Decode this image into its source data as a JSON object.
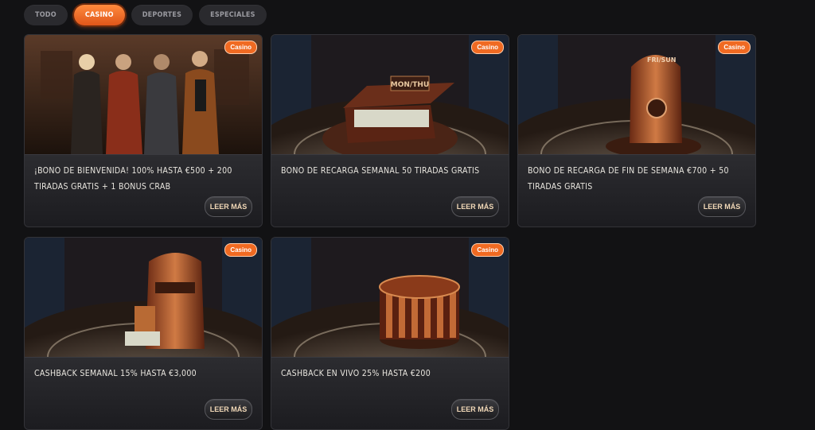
{
  "tabs": [
    {
      "label": "TODO",
      "active": false
    },
    {
      "label": "CASINO",
      "active": true
    },
    {
      "label": "DEPORTES",
      "active": false
    },
    {
      "label": "ESPECIALES",
      "active": false
    }
  ],
  "promotions": [
    {
      "badge": "Casino",
      "title": "¡BONO DE BIENVENIDA! 100% HASTA €500 + 200 TIRADAS GRATIS + 1 BONUS CRAB",
      "button": "LEER MÁS",
      "image": "welcome-characters"
    },
    {
      "badge": "Casino",
      "title": "BONO DE RECARGA SEMANAL 50 TIRADAS GRATIS",
      "button": "LEER MÁS",
      "image": "money-briefcase",
      "image_label": "MON/THU"
    },
    {
      "badge": "Casino",
      "title": "BONO DE RECARGA DE FIN DE SEMANA €700 + 50 TIRADAS GRATIS",
      "button": "LEER MÁS",
      "image": "copper-safe",
      "image_label": "FRI/SUN"
    },
    {
      "badge": "Casino",
      "title": "CASHBACK SEMANAL 15% HASTA €3,000",
      "button": "LEER MÁS",
      "image": "copper-slot-machine"
    },
    {
      "badge": "Casino",
      "title": "CASHBACK EN VIVO 25% HASTA €200",
      "button": "LEER MÁS",
      "image": "money-drum"
    }
  ],
  "colors": {
    "accent": "#f06a22",
    "background": "#121214",
    "card": "#202024"
  }
}
